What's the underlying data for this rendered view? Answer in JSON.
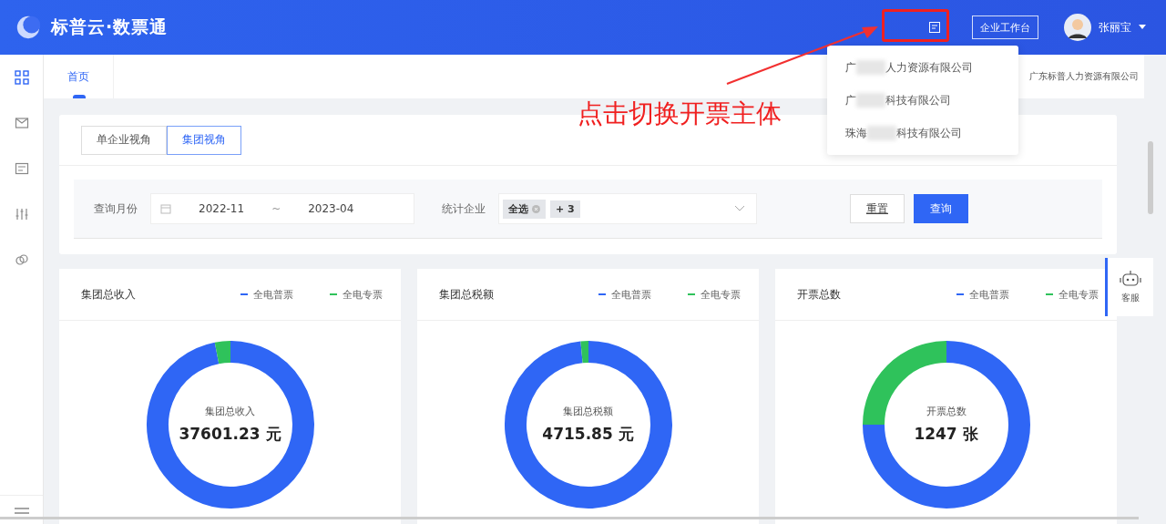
{
  "header": {
    "logo_text": "标普云·数票通",
    "workbench_button": "企业工作台",
    "user_name": "张丽宝"
  },
  "company_menu": [
    {
      "prefix": "广",
      "suffix": "人力资源有限公司"
    },
    {
      "prefix": "广",
      "suffix": "科技有限公司"
    },
    {
      "prefix": "珠海",
      "suffix": "科技有限公司"
    }
  ],
  "annotation": {
    "text": "点击切换开票主体"
  },
  "tabs": [
    {
      "label": "首页",
      "selected": true
    }
  ],
  "current_company": "广东标普人力资源有限公司",
  "view_switch": [
    {
      "label": "单企业视角",
      "selected": false
    },
    {
      "label": "集团视角",
      "selected": true
    }
  ],
  "filters": {
    "month_label": "查询月份",
    "start": "2022-11",
    "separator": "~",
    "end": "2023-04",
    "company_label": "统计企业",
    "tags": [
      "全选",
      "+ 3"
    ],
    "reset": "重置",
    "query": "查询"
  },
  "cards": [
    {
      "title": "集团总收入",
      "legend": [
        {
          "name": "全电普票",
          "color": "#2f66f5"
        },
        {
          "name": "全电专票",
          "color": "#2fc25b"
        }
      ],
      "center_label": "集团总收入",
      "center_value": "37601.23 元"
    },
    {
      "title": "集团总税额",
      "legend": [
        {
          "name": "全电普票",
          "color": "#2f66f5"
        },
        {
          "name": "全电专票",
          "color": "#2fc25b"
        }
      ],
      "center_label": "集团总税额",
      "center_value": "4715.85 元"
    },
    {
      "title": "开票总数",
      "legend": [
        {
          "name": "全电普票",
          "color": "#2f66f5"
        },
        {
          "name": "全电专票",
          "color": "#2fc25b"
        }
      ],
      "center_label": "开票总数",
      "center_value": "1247 张"
    }
  ],
  "service": {
    "label": "客服"
  }
}
